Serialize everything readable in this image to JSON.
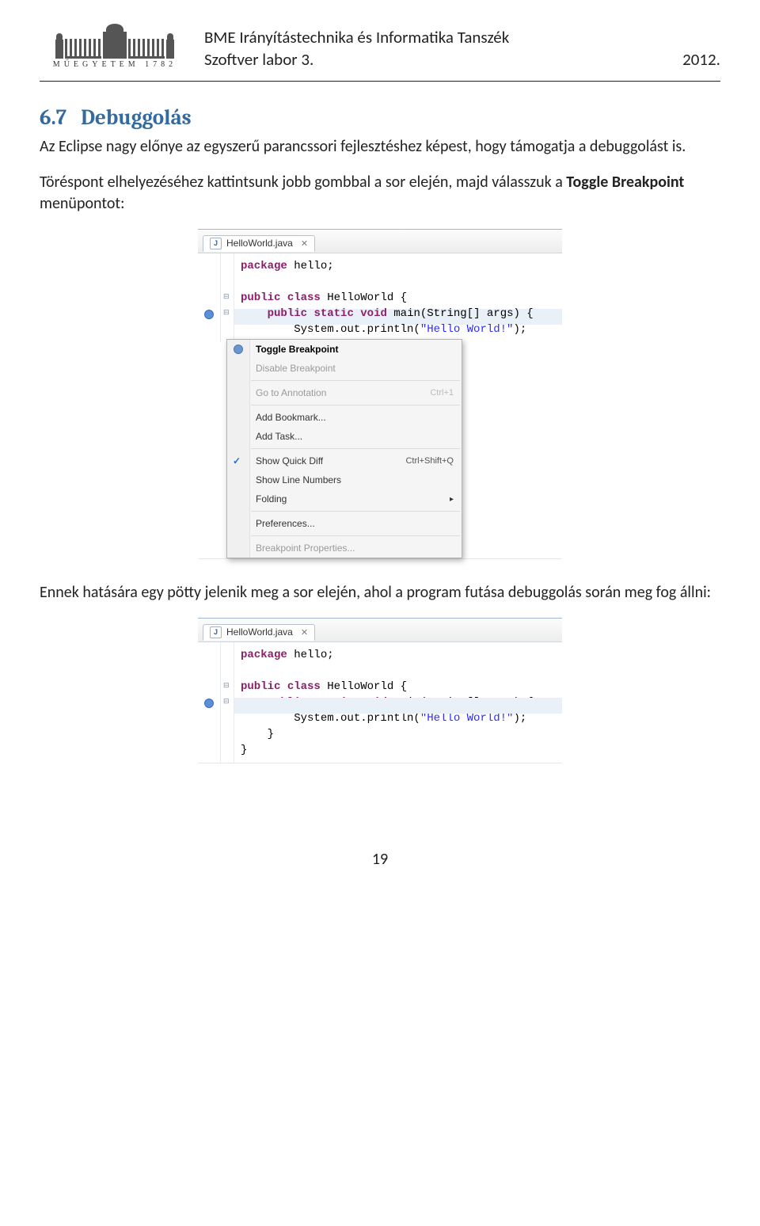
{
  "header": {
    "logo_caption": "MŰEGYETEM 1782",
    "line1": "BME Irányítástechnika és Informatika Tanszék",
    "line2_left": "Szoftver labor 3.",
    "line2_right": "2012."
  },
  "section": {
    "number": "6.7",
    "title": "Debuggolás"
  },
  "para1": "Az Eclipse nagy előnye az egyszerű parancssori fejlesztéshez képest, hogy támogatja a debuggolást is.",
  "para2_pre": "Töréspont elhelyezéséhez kattintsunk jobb gombbal a sor elején, majd válasszuk a ",
  "para2_bold": "Toggle Breakpoint",
  "para2_post": " menüpontot:",
  "screenshot1": {
    "tab_label": "HelloWorld.java",
    "code": {
      "l1": "package hello;",
      "l2": "",
      "l3": "public class HelloWorld {",
      "l4": "    public static void main(String[] args) {",
      "l5a": "        System.out.println(",
      "l5b": "\"Hello World!\"",
      "l5c": ");"
    },
    "menu": [
      {
        "label": "Toggle Breakpoint",
        "bold": true,
        "icon": "bp"
      },
      {
        "label": "Disable Breakpoint",
        "disabled": true
      },
      {
        "sep": true
      },
      {
        "label": "Go to Annotation",
        "shortcut": "Ctrl+1",
        "disabled": true
      },
      {
        "sep": true
      },
      {
        "label": "Add Bookmark..."
      },
      {
        "label": "Add Task..."
      },
      {
        "sep": true
      },
      {
        "label": "Show Quick Diff",
        "shortcut": "Ctrl+Shift+Q",
        "icon": "check"
      },
      {
        "label": "Show Line Numbers"
      },
      {
        "label": "Folding",
        "submenu": true
      },
      {
        "sep": true
      },
      {
        "label": "Preferences..."
      },
      {
        "sep": true
      },
      {
        "label": "Breakpoint Properties...",
        "disabled": true
      }
    ]
  },
  "para3": "Ennek hatására egy pötty jelenik meg a sor elején, ahol a program futása debuggolás során meg fog állni:",
  "screenshot2": {
    "tab_label": "HelloWorld.java",
    "code": {
      "l1": "package hello;",
      "l2": "",
      "l3": "public class HelloWorld {",
      "l4": "    public static void main(String[] args) {",
      "l5a": "        System.out.println(",
      "l5b": "\"Hello World!\"",
      "l5c": ");",
      "l6": "    }",
      "l7": "}"
    }
  },
  "page_number": "19"
}
